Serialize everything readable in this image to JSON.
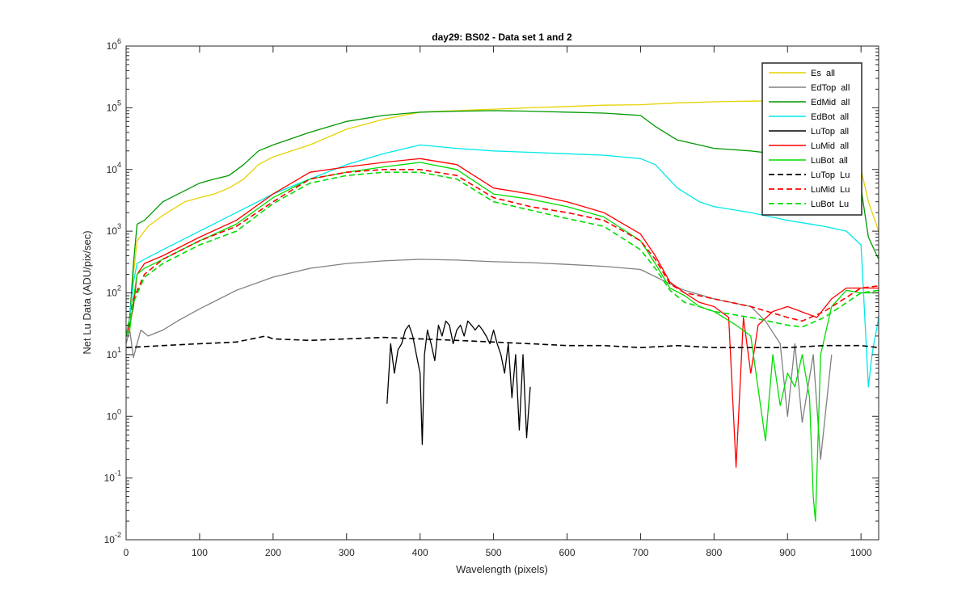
{
  "chart_data": {
    "type": "line",
    "title": "day29: BS02 - Data set 1 and 2",
    "xlabel": "Wavelength (pixels)",
    "ylabel": "Net Lu Data (ADU/pix/sec)",
    "xlim": [
      0,
      1024
    ],
    "ylim": [
      0.01,
      1000000
    ],
    "yscale": "log",
    "grid": false,
    "legend_position": "top-right",
    "x_ticks": [
      "0",
      "100",
      "200",
      "300",
      "400",
      "500",
      "600",
      "700",
      "800",
      "900",
      "1000"
    ],
    "y_ticks": [
      {
        "base": "10",
        "exp": "-2"
      },
      {
        "base": "10",
        "exp": "-1"
      },
      {
        "base": "10",
        "exp": "0"
      },
      {
        "base": "10",
        "exp": "1"
      },
      {
        "base": "10",
        "exp": "2"
      },
      {
        "base": "10",
        "exp": "3"
      },
      {
        "base": "10",
        "exp": "4"
      },
      {
        "base": "10",
        "exp": "5"
      },
      {
        "base": "10",
        "exp": "6"
      }
    ],
    "series": [
      {
        "name": "Es  all",
        "color": "#e6d200",
        "dash": "solid",
        "x": [
          0,
          5,
          10,
          15,
          30,
          50,
          80,
          100,
          120,
          140,
          160,
          180,
          200,
          250,
          300,
          350,
          400,
          450,
          500,
          550,
          600,
          650,
          700,
          750,
          800,
          850,
          900,
          950,
          980,
          1000,
          1010,
          1024
        ],
        "y": [
          20,
          40,
          200,
          700,
          1200,
          1800,
          3000,
          3500,
          4000,
          5000,
          7000,
          12000,
          16000,
          25000,
          45000,
          65000,
          85000,
          90000,
          95000,
          100000,
          105000,
          110000,
          112000,
          120000,
          125000,
          128000,
          130000,
          120000,
          70000,
          10000,
          3000,
          1000
        ]
      },
      {
        "name": "EdTop  all",
        "color": "#808080",
        "dash": "solid",
        "x": [
          0,
          5,
          10,
          15,
          20,
          30,
          50,
          70,
          100,
          150,
          200,
          250,
          300,
          350,
          400,
          450,
          500,
          550,
          600,
          650,
          700,
          740,
          760,
          800,
          850,
          870,
          890,
          900,
          910,
          920,
          935,
          945,
          960
        ],
        "y": [
          15,
          25,
          9,
          15,
          25,
          20,
          25,
          35,
          55,
          110,
          180,
          250,
          300,
          330,
          350,
          340,
          320,
          310,
          290,
          270,
          240,
          140,
          110,
          80,
          60,
          35,
          15,
          1,
          15,
          0.8,
          10,
          0.2,
          10
        ]
      },
      {
        "name": "EdMid  all",
        "color": "#009900",
        "dash": "solid",
        "x": [
          0,
          5,
          10,
          15,
          25,
          50,
          100,
          120,
          140,
          160,
          180,
          200,
          250,
          300,
          350,
          400,
          450,
          500,
          550,
          600,
          650,
          700,
          720,
          750,
          780,
          800,
          850,
          900,
          950,
          980,
          1000,
          1010,
          1024
        ],
        "y": [
          20,
          40,
          300,
          1300,
          1500,
          3000,
          6000,
          7000,
          8000,
          12000,
          20000,
          25000,
          40000,
          60000,
          75000,
          85000,
          88000,
          90000,
          88000,
          85000,
          82000,
          75000,
          50000,
          30000,
          25000,
          22000,
          20000,
          17000,
          14000,
          10000,
          5000,
          800,
          350
        ]
      },
      {
        "name": "EdBot  all",
        "color": "#00e8e8",
        "dash": "solid",
        "x": [
          0,
          5,
          10,
          15,
          25,
          50,
          100,
          150,
          200,
          250,
          300,
          350,
          400,
          450,
          500,
          550,
          600,
          650,
          700,
          720,
          750,
          780,
          800,
          850,
          900,
          950,
          980,
          1000,
          1010,
          1015,
          1024
        ],
        "y": [
          20,
          40,
          150,
          300,
          350,
          500,
          1000,
          2000,
          4000,
          7000,
          12000,
          18000,
          25000,
          22000,
          20000,
          19000,
          18000,
          17000,
          15000,
          12000,
          5000,
          3000,
          2500,
          2000,
          1500,
          1200,
          1000,
          600,
          3,
          10,
          40
        ]
      },
      {
        "name": "LuTop  all",
        "color": "#000000",
        "dash": "solid",
        "x": [
          355,
          360,
          365,
          370,
          375,
          380,
          385,
          390,
          395,
          400,
          403,
          406,
          410,
          415,
          420,
          425,
          430,
          435,
          440,
          445,
          450,
          455,
          460,
          465,
          470,
          475,
          480,
          485,
          490,
          495,
          500,
          505,
          510,
          515,
          520,
          525,
          530,
          535,
          540,
          545,
          550
        ],
        "y": [
          1.6,
          15,
          5,
          12,
          15,
          25,
          30,
          20,
          10,
          5,
          0.35,
          10,
          25,
          15,
          8,
          30,
          20,
          35,
          30,
          15,
          25,
          30,
          20,
          35,
          30,
          25,
          30,
          25,
          20,
          15,
          25,
          15,
          10,
          5,
          15,
          2,
          10,
          0.6,
          10,
          0.45,
          3
        ]
      },
      {
        "name": "LuMid  all",
        "color": "#ff0000",
        "dash": "solid",
        "x": [
          0,
          5,
          10,
          15,
          25,
          50,
          100,
          150,
          200,
          250,
          300,
          350,
          400,
          450,
          500,
          550,
          600,
          650,
          700,
          720,
          740,
          760,
          780,
          800,
          820,
          830,
          840,
          850,
          860,
          880,
          900,
          940,
          960,
          980,
          1000,
          1024
        ],
        "y": [
          20,
          30,
          60,
          200,
          300,
          400,
          800,
          1500,
          4000,
          9000,
          11000,
          13000,
          15000,
          12000,
          5000,
          4000,
          3000,
          2000,
          900,
          400,
          150,
          100,
          70,
          60,
          40,
          0.15,
          40,
          5,
          30,
          50,
          60,
          40,
          80,
          120,
          120,
          120
        ]
      },
      {
        "name": "LuBot  all",
        "color": "#00dd00",
        "dash": "solid",
        "x": [
          0,
          5,
          10,
          15,
          25,
          50,
          100,
          150,
          200,
          250,
          300,
          350,
          400,
          450,
          500,
          550,
          600,
          650,
          700,
          720,
          740,
          760,
          780,
          800,
          830,
          850,
          870,
          880,
          890,
          900,
          910,
          920,
          930,
          935,
          938,
          945,
          960,
          980,
          1000,
          1024
        ],
        "y": [
          20,
          25,
          80,
          200,
          250,
          350,
          700,
          1300,
          3500,
          7000,
          9000,
          11000,
          13000,
          10000,
          4000,
          3300,
          2500,
          1700,
          700,
          300,
          120,
          90,
          60,
          50,
          30,
          20,
          0.4,
          10,
          1.5,
          5,
          3,
          10,
          2,
          0.05,
          0.02,
          10,
          60,
          110,
          100,
          100
        ]
      },
      {
        "name": "LuTop  Lu",
        "color": "#000000",
        "dash": "dashed",
        "x": [
          0,
          50,
          100,
          150,
          190,
          200,
          250,
          300,
          350,
          400,
          450,
          500,
          550,
          600,
          650,
          700,
          750,
          800,
          850,
          900,
          950,
          1000,
          1024
        ],
        "y": [
          13,
          14,
          15,
          16,
          20,
          18,
          17,
          18,
          19,
          18,
          17,
          16,
          15,
          14,
          14,
          13,
          14,
          13,
          13,
          13,
          14,
          14,
          13
        ]
      },
      {
        "name": "LuMid  Lu",
        "color": "#ff0000",
        "dash": "dashed",
        "x": [
          0,
          10,
          25,
          50,
          100,
          150,
          200,
          250,
          300,
          350,
          400,
          450,
          500,
          550,
          600,
          650,
          700,
          720,
          740,
          760,
          780,
          800,
          850,
          900,
          920,
          950,
          1000,
          1024
        ],
        "y": [
          20,
          80,
          200,
          350,
          700,
          1200,
          3000,
          7000,
          9000,
          10000,
          10000,
          8000,
          3500,
          2500,
          2000,
          1500,
          700,
          350,
          140,
          100,
          90,
          80,
          60,
          40,
          35,
          50,
          120,
          130
        ]
      },
      {
        "name": "LuBot  Lu",
        "color": "#00dd00",
        "dash": "dashed",
        "x": [
          0,
          10,
          25,
          50,
          100,
          150,
          200,
          250,
          300,
          350,
          400,
          450,
          500,
          550,
          600,
          650,
          700,
          720,
          740,
          760,
          780,
          800,
          850,
          900,
          920,
          950,
          1000,
          1024
        ],
        "y": [
          20,
          70,
          180,
          300,
          600,
          1000,
          2800,
          6000,
          8000,
          9000,
          9000,
          7000,
          3000,
          2200,
          1600,
          1200,
          500,
          250,
          110,
          70,
          60,
          50,
          40,
          30,
          28,
          40,
          100,
          110
        ]
      }
    ]
  }
}
